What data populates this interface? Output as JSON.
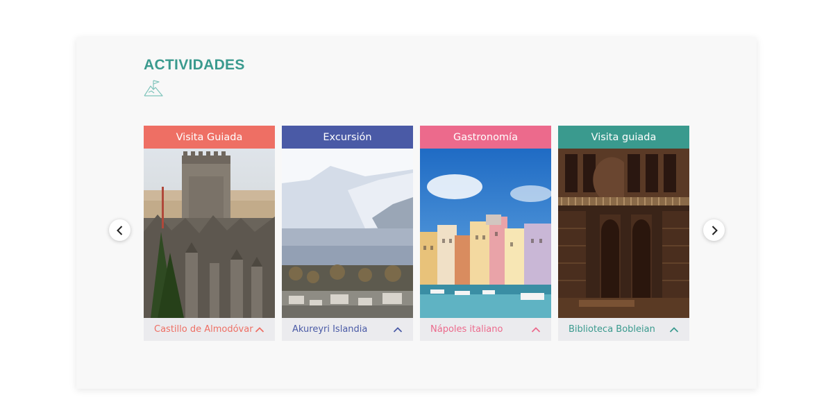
{
  "section": {
    "title": "ACTIVIDADES",
    "icon": "mountain-flag-icon",
    "accent": "#3a9a8e"
  },
  "nav": {
    "prev_icon": "chevron-left-icon",
    "next_icon": "chevron-right-icon"
  },
  "cards": [
    {
      "category": "Visita Guiada",
      "name": "Castillo de Almodóvar",
      "color": "#ee6f64",
      "image": "castle-photo",
      "toggle_icon": "chevron-up-icon"
    },
    {
      "category": "Excursión",
      "name": "Akureyri Islandia",
      "color": "#4a5aa6",
      "image": "snowy-mountain-town-photo",
      "toggle_icon": "chevron-up-icon"
    },
    {
      "category": "Gastronomía",
      "name": "Nápoles italiano",
      "color": "#ec6a8c",
      "image": "colorful-harbor-photo",
      "toggle_icon": "chevron-up-icon"
    },
    {
      "category": "Visita guiada",
      "name": "Biblioteca Bobleian",
      "color": "#3a9a8e",
      "image": "library-interior-photo",
      "toggle_icon": "chevron-up-icon"
    }
  ]
}
